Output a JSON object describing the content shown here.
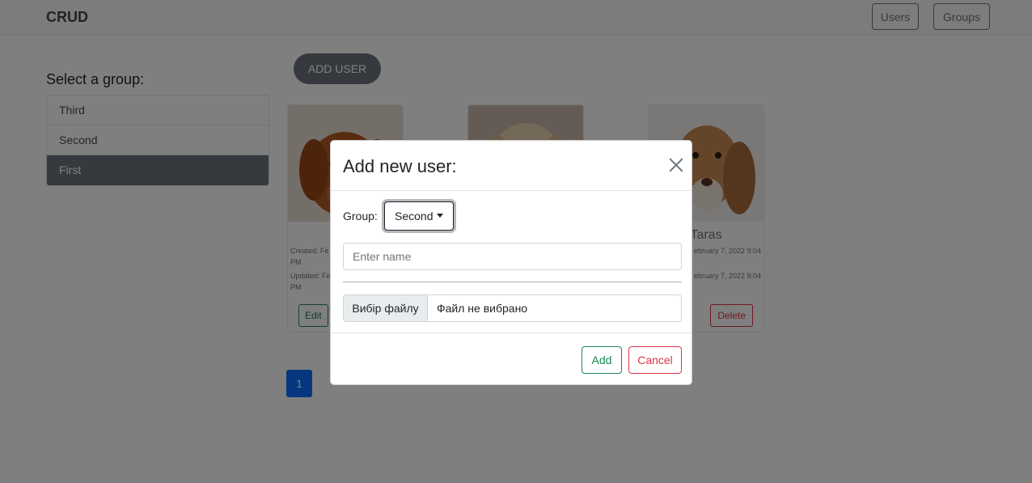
{
  "navbar": {
    "brand": "CRUD",
    "users_label": "Users",
    "groups_label": "Groups"
  },
  "sidebar": {
    "title": "Select a group:",
    "groups": [
      {
        "label": "Third",
        "active": false
      },
      {
        "label": "Second",
        "active": false
      },
      {
        "label": "First",
        "active": true
      }
    ]
  },
  "main": {
    "add_user_label": "ADD USER",
    "cards": [
      {
        "name": "S",
        "created": "Created: Fe",
        "created_cont": "PM",
        "updated": "Updated: Fe",
        "updated_cont": "PM",
        "edit_label": "Edit",
        "photo": "dog-photo"
      },
      {
        "name": "",
        "photo": "dog-photo"
      },
      {
        "name": "Taras",
        "created": "ebruary 7, 2022 9:04",
        "updated": "ebruary 7, 2022 9:04",
        "delete_label": "Delete",
        "photo": "dog-photo"
      }
    ],
    "pagination": {
      "current_page": "1"
    }
  },
  "modal": {
    "title": "Add new user:",
    "group_label": "Group:",
    "group_selected": "Second",
    "name_placeholder": "Enter name",
    "file_button": "Вибір файлу",
    "file_status": "Файл не вибрано",
    "add_label": "Add",
    "cancel_label": "Cancel"
  },
  "colors": {
    "primary": "#0d6efd",
    "success": "#198754",
    "danger": "#dc3545",
    "secondary": "#6c757d"
  }
}
